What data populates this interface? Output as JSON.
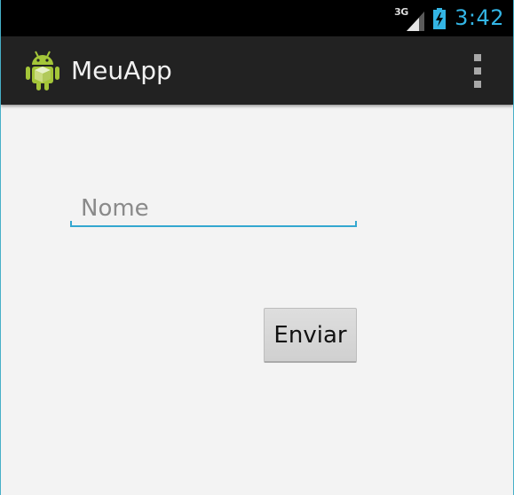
{
  "status_bar": {
    "network_type": "3G",
    "time": "3:42",
    "signal_icon": "signal-bars-icon",
    "battery_icon": "battery-charging-icon",
    "accent_color": "#33b5e5"
  },
  "action_bar": {
    "app_icon": "android-robot-icon",
    "title": "MeuApp",
    "overflow_icon": "overflow-menu-icon"
  },
  "form": {
    "name_placeholder": "Nome",
    "name_value": "",
    "submit_label": "Enviar",
    "field_accent_color": "#33a7d0"
  }
}
